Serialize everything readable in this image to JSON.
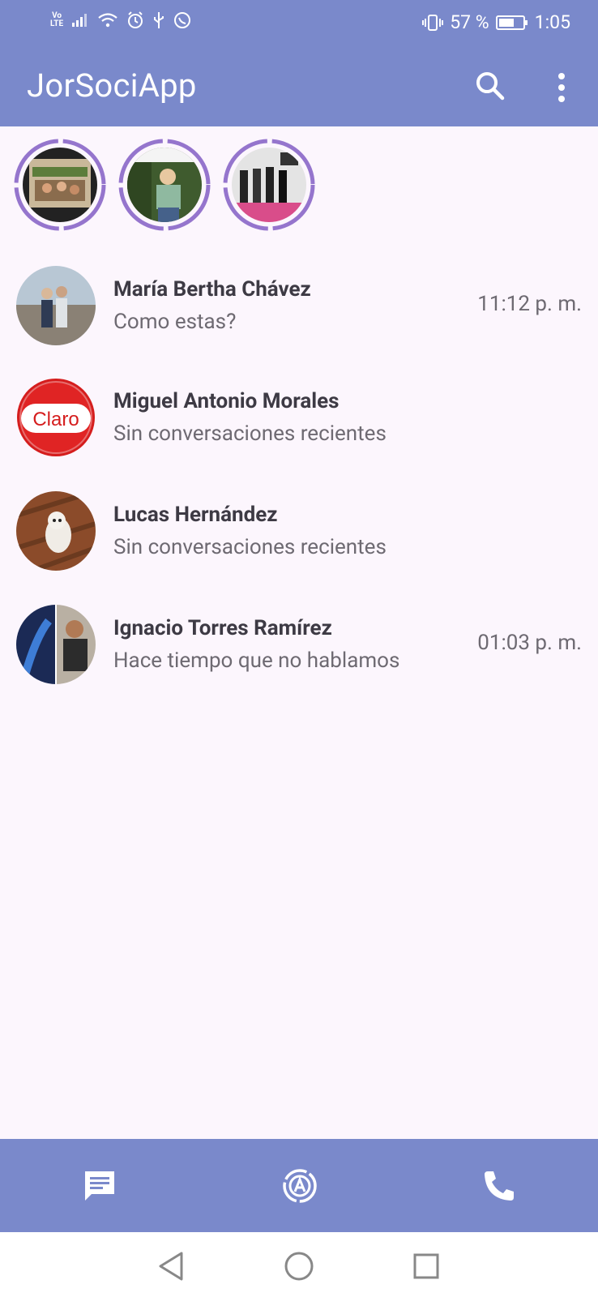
{
  "status_bar": {
    "volte_top": "Vo",
    "volte_bottom": "LTE",
    "battery": "57 %",
    "time": "1:05"
  },
  "app": {
    "title": "JorSociApp",
    "accent": "#7a89cb",
    "story_ring_color": "#9575cd"
  },
  "stories": [
    {
      "name": "story-1"
    },
    {
      "name": "story-2"
    },
    {
      "name": "story-3"
    }
  ],
  "chats": [
    {
      "name": "María Bertha Chávez",
      "message": "Como estas?",
      "time": "11:12 p. m."
    },
    {
      "name": "Miguel Antonio Morales",
      "message": "Sin conversaciones recientes",
      "time": "",
      "avatar_text": "Claro"
    },
    {
      "name": "Lucas Hernández",
      "message": "Sin conversaciones recientes",
      "time": ""
    },
    {
      "name": "Ignacio Torres Ramírez",
      "message": "Hace tiempo que no hablamos",
      "time": "01:03 p. m."
    }
  ],
  "bottom_nav": {
    "items": [
      {
        "icon": "chat-icon"
      },
      {
        "icon": "status-icon"
      },
      {
        "icon": "phone-icon"
      }
    ]
  }
}
